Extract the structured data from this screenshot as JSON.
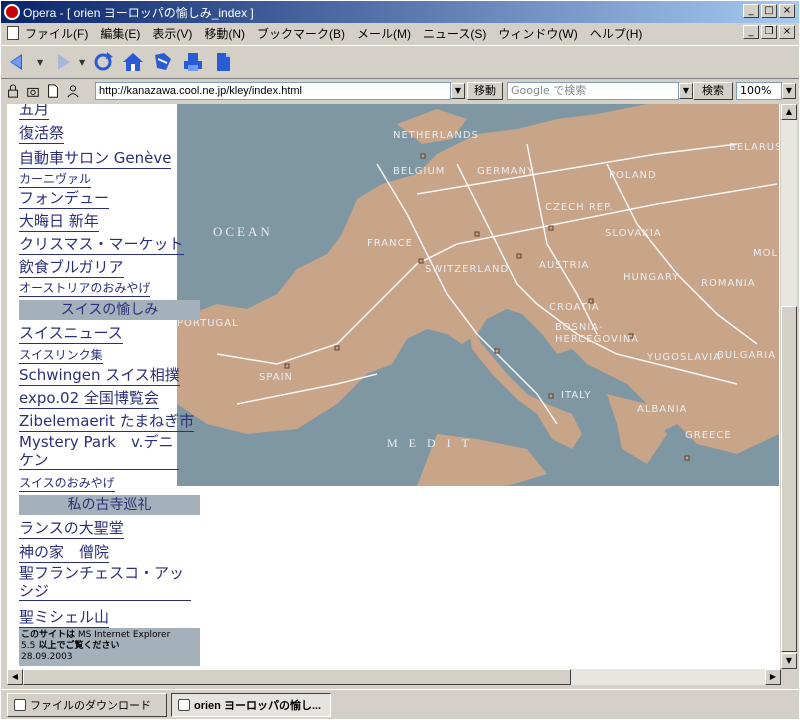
{
  "window": {
    "title": "Opera - [ orien ヨーロッパの愉しみ_index ]",
    "controls": [
      "_",
      "□",
      "×"
    ]
  },
  "menu": [
    "ファイル(F)",
    "編集(E)",
    "表示(V)",
    "移動(N)",
    "ブックマーク(B)",
    "メール(M)",
    "ニュース(S)",
    "ウィンドウ(W)",
    "ヘルプ(H)"
  ],
  "mdi_controls": [
    "_",
    "❐",
    "×"
  ],
  "address": {
    "url": "http://kanazawa.cool.ne.jp/kley/index.html",
    "go_label": "移動",
    "search_placeholder": "Google で検索",
    "search_label": "検索",
    "zoom": "100%"
  },
  "sidebar": {
    "items_top": [
      {
        "label": "五月",
        "size": "lg"
      },
      {
        "label": "復活祭",
        "size": "lg"
      },
      {
        "label": "自動車サロン Genève",
        "size": "lg"
      },
      {
        "label": "カーニヴァル",
        "size": "sm"
      },
      {
        "label": "フォンデュー",
        "size": "lg"
      },
      {
        "label": "大晦日 新年",
        "size": "lg"
      },
      {
        "label": "クリスマス・マーケット",
        "size": "lg"
      },
      {
        "label": "飲食ブルガリア",
        "size": "lg"
      },
      {
        "label": "オーストリアのおみやげ",
        "size": "sm"
      }
    ],
    "section_swiss": "スイスの愉しみ",
    "items_swiss": [
      {
        "label": "スイスニュース",
        "size": "lg"
      },
      {
        "label": "スイスリンク集",
        "size": "sm"
      },
      {
        "label": "Schwingen スイス相撲",
        "size": "lg"
      },
      {
        "label": "expo.02 全国博覧会",
        "size": "lg"
      },
      {
        "label": "Zibelemaerit たまねぎ市",
        "size": "lg"
      },
      {
        "label": "Mystery Park　v.デニケン",
        "size": "lg"
      },
      {
        "label": "スイスのおみやげ",
        "size": "sm"
      }
    ],
    "section_temple": "私の古寺巡礼",
    "items_temple": [
      {
        "label": "ランスの大聖堂",
        "size": "lg"
      },
      {
        "label": "神の家　僧院",
        "size": "lg"
      },
      {
        "label": "聖フランチェスコ・アッシジ",
        "size": "lg"
      },
      {
        "label": "聖ミシェル山",
        "size": "lg"
      }
    ],
    "footer": {
      "line1_bold": "このサイトは",
      "line1_rest": " MS Internet Explorer",
      "line2_version": "5.5",
      "line2_bold": " 以上でご覧ください",
      "date": "28.09.2003"
    }
  },
  "map": {
    "labels": {
      "ocean": "OCEAN",
      "netherlands": "NETHERLANDS",
      "belgium": "BELGIUM",
      "germany": "GERMANY",
      "poland": "POLAND",
      "belarus": "BELARUS",
      "czech": "CZECH REP.",
      "slovakia": "SLOVAKIA",
      "france": "FRANCE",
      "switzerland": "SWITZERLAND",
      "austria": "AUSTRIA",
      "hungary": "HUNGARY",
      "romania": "ROMANIA",
      "moldova": "MOLD",
      "portugal": "PORTUGAL",
      "spain": "SPAIN",
      "croatia": "CROATIA",
      "bosnia": "BOSNIA-HERCEGOVINA",
      "yugoslavia": "YUGOSLAVIA",
      "bulgaria": "BULGARIA",
      "italy": "ITALY",
      "albania": "ALBANIA",
      "greece": "GREECE",
      "medit": "M E D I T"
    },
    "colors": {
      "sea": "#7e97a3",
      "land": "#c8a488",
      "roads": "#ffffff"
    }
  },
  "taskbar": [
    {
      "label": "ファイルのダウンロード",
      "active": false
    },
    {
      "label": "orien ヨーロッパの愉し...",
      "active": true
    }
  ]
}
